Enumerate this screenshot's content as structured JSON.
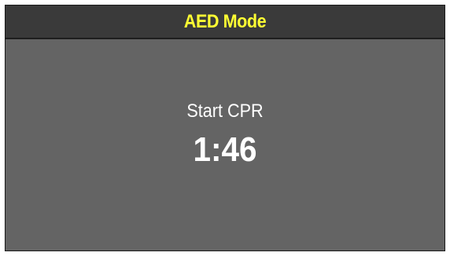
{
  "header": {
    "title": "AED Mode",
    "title_color": "#ffff33",
    "background_color": "#3a3a3a"
  },
  "main": {
    "instruction": "Start CPR",
    "timer": "1:46",
    "background_color": "#646464",
    "text_color": "#ffffff"
  }
}
